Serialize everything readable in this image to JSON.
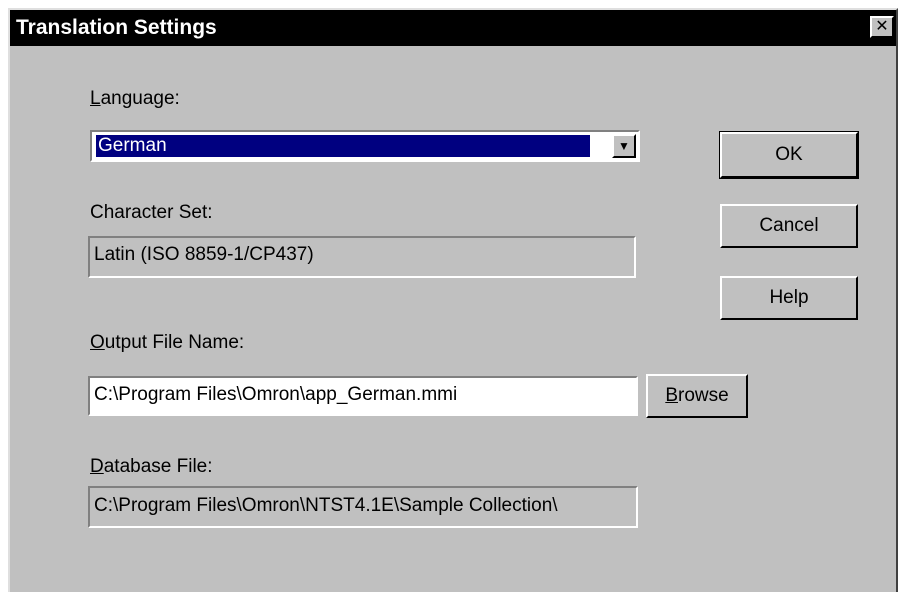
{
  "dialog": {
    "title": "Translation Settings",
    "close_glyph": "✕"
  },
  "language": {
    "label_prefix": "",
    "label_accel": "L",
    "label_rest": "anguage:",
    "selected": "German",
    "arrow_glyph": "▼"
  },
  "charset": {
    "label": "Character Set:",
    "value": "Latin (ISO 8859-1/CP437)"
  },
  "output": {
    "label_accel": "O",
    "label_rest": "utput File Name:",
    "value": "C:\\Program Files\\Omron\\app_German.mmi"
  },
  "database": {
    "label_accel": "D",
    "label_rest": "atabase File:",
    "value": "C:\\Program Files\\Omron\\NTST4.1E\\Sample Collection\\"
  },
  "buttons": {
    "ok": "OK",
    "cancel": "Cancel",
    "help": "Help",
    "browse_accel": "B",
    "browse_rest": "rowse"
  }
}
